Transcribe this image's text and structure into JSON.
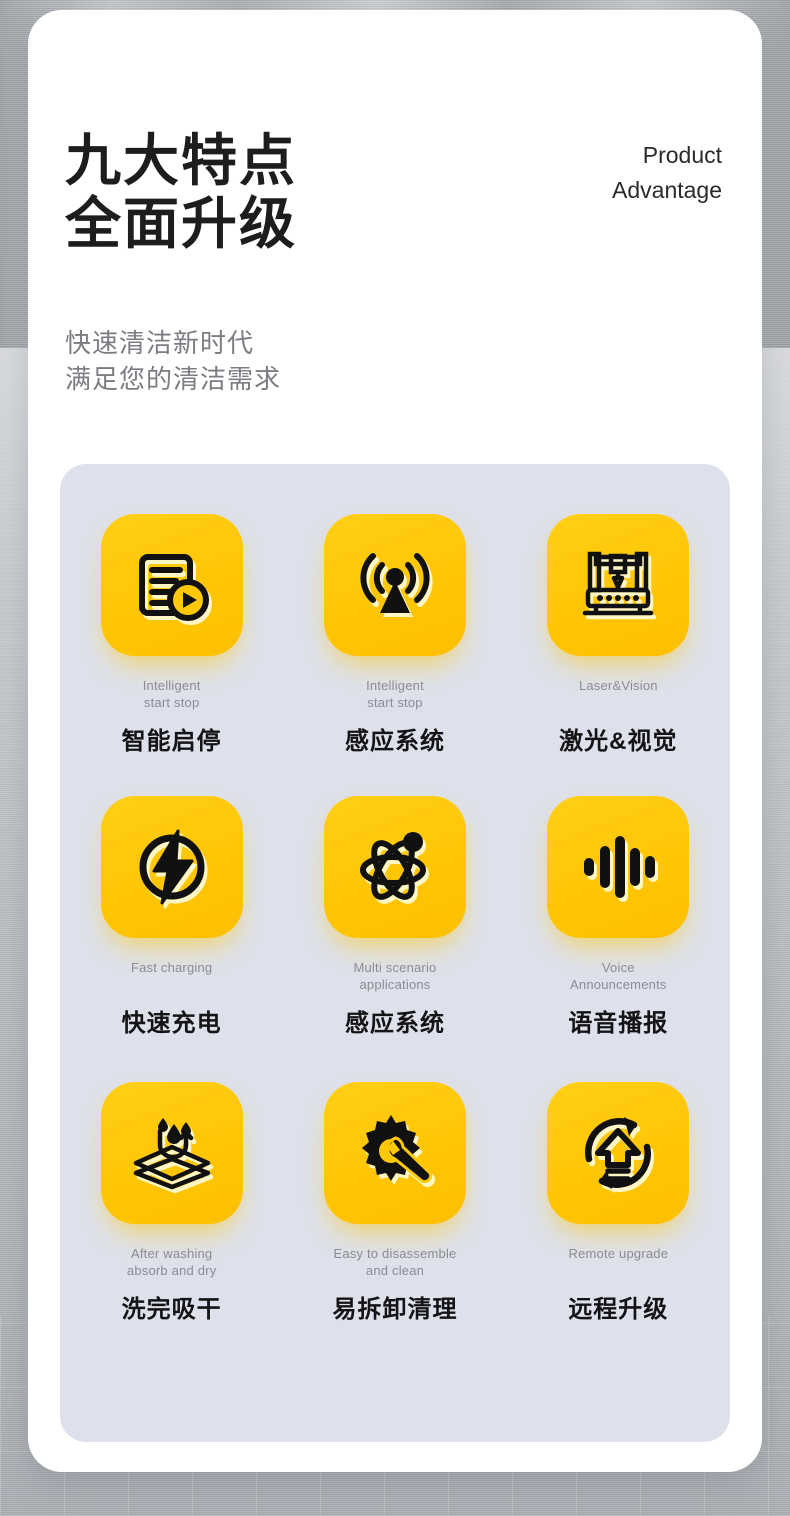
{
  "page": {
    "background_top_color": "#b4b8bc",
    "background_bottom_color": "#bcbfc3",
    "card_color": "#ffffff",
    "panel_color": "#dee1eb",
    "accent_color": "#ffc907",
    "text_color": "#1d1d1f",
    "muted_color": "#8a8c93"
  },
  "header": {
    "headline_line1": "九大特点",
    "headline_line2": "全面升级",
    "subtitle_line1": "快速清洁新时代",
    "subtitle_line2": "满足您的清洁需求",
    "eyebrow_line1": "Product",
    "eyebrow_line2": "Advantage"
  },
  "features": [
    {
      "icon": "document-play-icon",
      "en_line1": "Intelligent",
      "en_line2": "start stop",
      "cn": "智能启停"
    },
    {
      "icon": "signal-sensor-icon",
      "en_line1": "Intelligent",
      "en_line2": "start stop",
      "cn": "感应系统"
    },
    {
      "icon": "laser-machine-icon",
      "en_line1": "Laser&Vision",
      "en_line2": "",
      "cn": "激光&视觉"
    },
    {
      "icon": "lightning-bolt-icon",
      "en_line1": "Fast charging",
      "en_line2": "",
      "cn": "快速充电"
    },
    {
      "icon": "atom-icon",
      "en_line1": "Multi scenario",
      "en_line2": "applications",
      "cn": "感应系统"
    },
    {
      "icon": "voice-waveform-icon",
      "en_line1": "Voice",
      "en_line2": "Announcements",
      "cn": "语音播报"
    },
    {
      "icon": "water-drop-layers-icon",
      "en_line1": "After washing",
      "en_line2": "absorb and dry",
      "cn": "洗完吸干"
    },
    {
      "icon": "gear-wrench-icon",
      "en_line1": "Easy to disassemble",
      "en_line2": "and clean",
      "cn": "易拆卸清理"
    },
    {
      "icon": "refresh-upgrade-icon",
      "en_line1": "Remote upgrade",
      "en_line2": "",
      "cn": "远程升级"
    }
  ]
}
